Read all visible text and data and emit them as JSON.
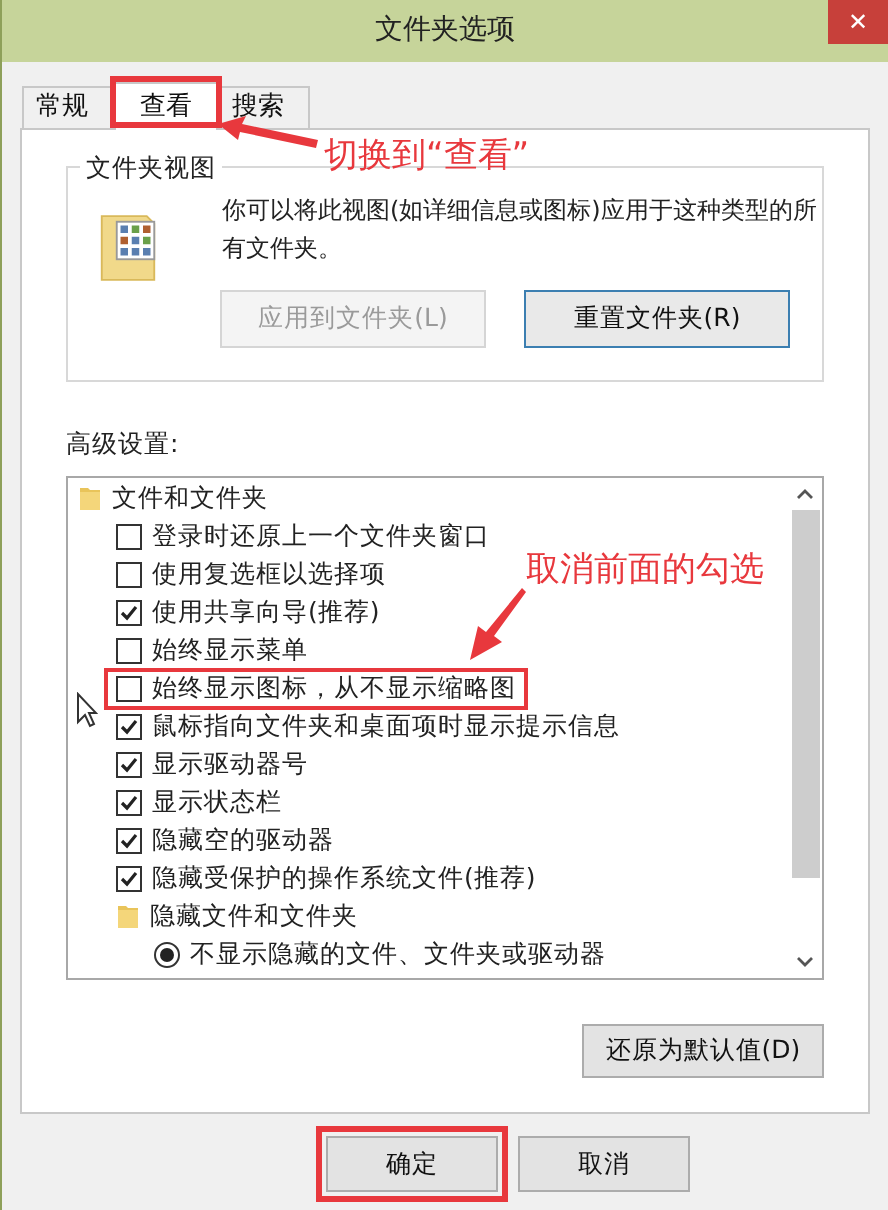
{
  "window": {
    "title": "文件夹选项",
    "close": "✕"
  },
  "tabs": [
    {
      "label": "常规",
      "selected": false,
      "highlighted": false
    },
    {
      "label": "查看",
      "selected": true,
      "highlighted": true
    },
    {
      "label": "搜索",
      "selected": false,
      "highlighted": false
    }
  ],
  "folder_views": {
    "title": "文件夹视图",
    "description": "你可以将此视图(如详细信息或图标)应用于这种类型的所有文件夹。",
    "buttons": [
      {
        "label": "应用到文件夹(L)",
        "disabled": true,
        "focused": false
      },
      {
        "label": "重置文件夹(R)",
        "disabled": false,
        "focused": true
      }
    ]
  },
  "advanced": {
    "label": "高级设置:",
    "items": [
      {
        "kind": "folder",
        "label": "文件和文件夹",
        "highlighted": false
      },
      {
        "kind": "checkbox",
        "label": "登录时还原上一个文件夹窗口",
        "checked": false,
        "highlighted": false
      },
      {
        "kind": "checkbox",
        "label": "使用复选框以选择项",
        "checked": false,
        "highlighted": false
      },
      {
        "kind": "checkbox",
        "label": "使用共享向导(推荐)",
        "checked": true,
        "highlighted": false
      },
      {
        "kind": "checkbox",
        "label": "始终显示菜单",
        "checked": false,
        "highlighted": false
      },
      {
        "kind": "checkbox",
        "label": "始终显示图标，从不显示缩略图",
        "checked": false,
        "highlighted": true
      },
      {
        "kind": "checkbox",
        "label": "鼠标指向文件夹和桌面项时显示提示信息",
        "checked": true,
        "highlighted": false
      },
      {
        "kind": "checkbox",
        "label": "显示驱动器号",
        "checked": true,
        "highlighted": false
      },
      {
        "kind": "checkbox",
        "label": "显示状态栏",
        "checked": true,
        "highlighted": false
      },
      {
        "kind": "checkbox",
        "label": "隐藏空的驱动器",
        "checked": true,
        "highlighted": false
      },
      {
        "kind": "checkbox",
        "label": "隐藏受保护的操作系统文件(推荐)",
        "checked": true,
        "highlighted": false
      },
      {
        "kind": "subfolder",
        "label": "隐藏文件和文件夹",
        "highlighted": false
      },
      {
        "kind": "radio",
        "label": "不显示隐藏的文件、文件夹或驱动器",
        "selected": true,
        "highlighted": false
      }
    ],
    "restore_button": "还原为默认值(D)"
  },
  "footer_buttons": [
    {
      "label": "确定",
      "highlighted": true
    },
    {
      "label": "取消",
      "highlighted": false
    }
  ],
  "annotations": [
    {
      "text": "切换到“查看”"
    },
    {
      "text": "取消前面的勾选"
    }
  ]
}
